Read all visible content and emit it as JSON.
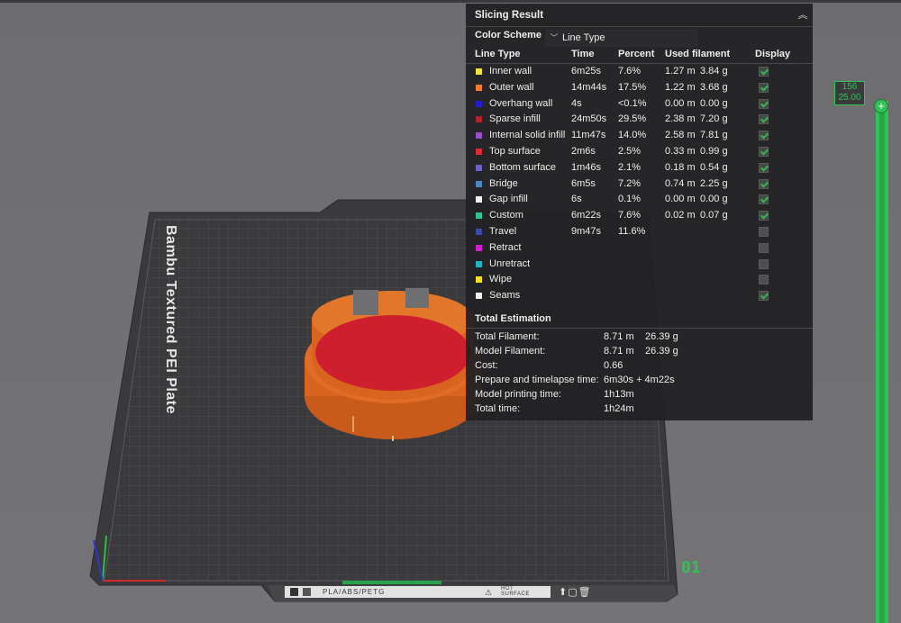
{
  "panel": {
    "title": "Slicing Result",
    "color_scheme_label": "Color Scheme",
    "color_scheme_value": "Line Type",
    "headers": {
      "line_type": "Line Type",
      "time": "Time",
      "percent": "Percent",
      "used_filament": "Used filament",
      "display": "Display"
    },
    "rows": [
      {
        "name": "Inner wall",
        "color": "#f4e43a",
        "time": "6m25s",
        "percent": "7.6%",
        "length": "1.27 m",
        "weight": "3.84 g",
        "display": true
      },
      {
        "name": "Outer wall",
        "color": "#ef7e2e",
        "time": "14m44s",
        "percent": "17.5%",
        "length": "1.22 m",
        "weight": "3.68 g",
        "display": true
      },
      {
        "name": "Overhang wall",
        "color": "#1e1ed0",
        "time": "4s",
        "percent": "<0.1%",
        "length": "0.00 m",
        "weight": "0.00 g",
        "display": true
      },
      {
        "name": "Sparse infill",
        "color": "#b3202a",
        "time": "24m50s",
        "percent": "29.5%",
        "length": "2.38 m",
        "weight": "7.20 g",
        "display": true
      },
      {
        "name": "Internal solid infill",
        "color": "#9b4fc6",
        "time": "11m47s",
        "percent": "14.0%",
        "length": "2.58 m",
        "weight": "7.81 g",
        "display": true
      },
      {
        "name": "Top surface",
        "color": "#e0283a",
        "time": "2m6s",
        "percent": "2.5%",
        "length": "0.33 m",
        "weight": "0.99 g",
        "display": true
      },
      {
        "name": "Bottom surface",
        "color": "#6b62c8",
        "time": "1m46s",
        "percent": "2.1%",
        "length": "0.18 m",
        "weight": "0.54 g",
        "display": true
      },
      {
        "name": "Bridge",
        "color": "#4b86c2",
        "time": "6m5s",
        "percent": "7.2%",
        "length": "0.74 m",
        "weight": "2.25 g",
        "display": true
      },
      {
        "name": "Gap infill",
        "color": "#f2f2f2",
        "time": "6s",
        "percent": "0.1%",
        "length": "0.00 m",
        "weight": "0.00 g",
        "display": true
      },
      {
        "name": "Custom",
        "color": "#2fc48c",
        "time": "6m22s",
        "percent": "7.6%",
        "length": "0.02 m",
        "weight": "0.07 g",
        "display": true
      },
      {
        "name": "Travel",
        "color": "#3a4aa8",
        "time": "9m47s",
        "percent": "11.6%",
        "length": "",
        "weight": "",
        "display": false
      },
      {
        "name": "Retract",
        "color": "#d21fd2",
        "time": "",
        "percent": "",
        "length": "",
        "weight": "",
        "display": false
      },
      {
        "name": "Unretract",
        "color": "#1fb2c4",
        "time": "",
        "percent": "",
        "length": "",
        "weight": "",
        "display": false
      },
      {
        "name": "Wipe",
        "color": "#f2e21f",
        "time": "",
        "percent": "",
        "length": "",
        "weight": "",
        "display": false
      },
      {
        "name": "Seams",
        "color": "#f0f0f0",
        "time": "",
        "percent": "",
        "length": "",
        "weight": "",
        "display": true
      }
    ],
    "total_title": "Total Estimation",
    "totals": [
      {
        "label": "Total Filament:",
        "v1": "8.71 m",
        "v2": "26.39 g"
      },
      {
        "label": "Model Filament:",
        "v1": "8.71 m",
        "v2": "26.39 g"
      },
      {
        "label": "Cost:",
        "v1": "0.66",
        "v2": ""
      },
      {
        "label": "Prepare and timelapse time:",
        "v1": "6m30s + 4m22s",
        "v2": ""
      },
      {
        "label": "Model printing time:",
        "v1": "1h13m",
        "v2": ""
      },
      {
        "label": "Total time:",
        "v1": "1h24m",
        "v2": ""
      }
    ]
  },
  "slider": {
    "top_layer": "156",
    "top_height": "25.00",
    "handle_icon": "+"
  },
  "plate": {
    "name": "Bambu Textured PEI Plate",
    "number": "01",
    "material_label": "PLA/ABS/PETG",
    "hot_surface_line1": "HOT",
    "hot_surface_line2": "SURFACE"
  },
  "colors": {
    "accent": "#2fc254",
    "panel_bg": "#222224",
    "model_top": "#cf1f2e",
    "model_wall": "#d8641f"
  }
}
